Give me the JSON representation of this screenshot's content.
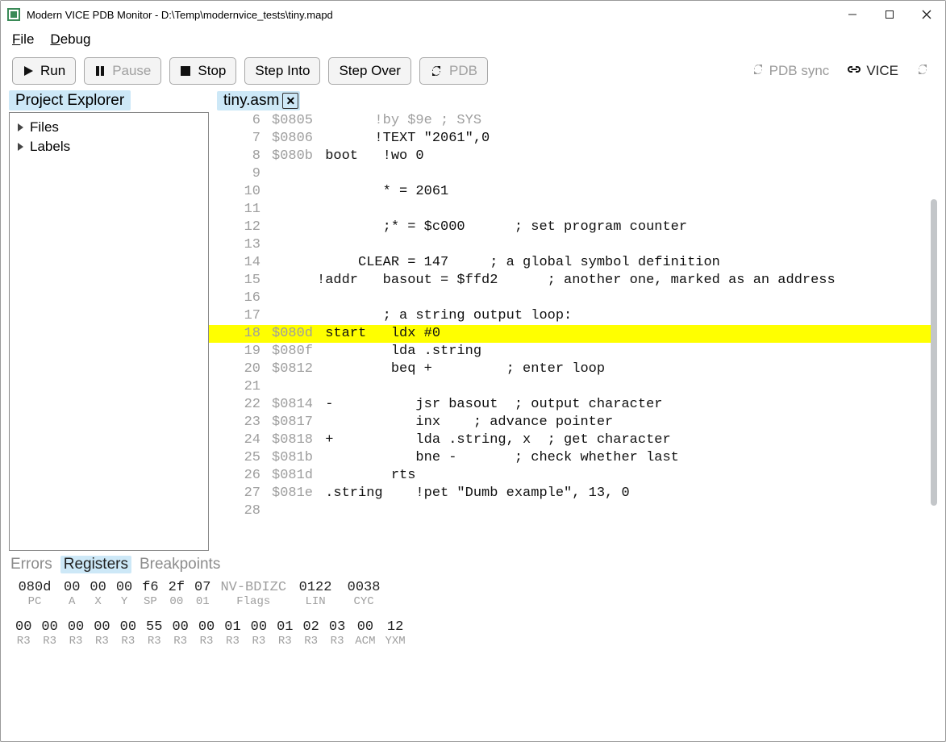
{
  "window": {
    "title": "Modern VICE PDB Monitor - D:\\Temp\\modernvice_tests\\tiny.mapd"
  },
  "menu": {
    "file": "File",
    "debug": "Debug"
  },
  "toolbar": {
    "run": "Run",
    "pause": "Pause",
    "stop": "Stop",
    "step_into": "Step Into",
    "step_over": "Step Over",
    "pdb": "PDB",
    "pdb_sync": "PDB sync",
    "vice": "VICE"
  },
  "panels": {
    "project_explorer": "Project Explorer",
    "file_tab": "tiny.asm"
  },
  "explorer": {
    "files": "Files",
    "labels": "Labels"
  },
  "code": {
    "rows": [
      {
        "ln": "6",
        "addr": "$0805",
        "text": "       !by $9e ; SYS",
        "current": false,
        "faded": true
      },
      {
        "ln": "7",
        "addr": "$0806",
        "text": "       !TEXT \"2061\",0",
        "current": false
      },
      {
        "ln": "8",
        "addr": "$080b",
        "text": " boot   !wo 0",
        "current": false
      },
      {
        "ln": "9",
        "addr": "",
        "text": "",
        "current": false
      },
      {
        "ln": "10",
        "addr": "",
        "text": "        * = 2061",
        "current": false
      },
      {
        "ln": "11",
        "addr": "",
        "text": "",
        "current": false
      },
      {
        "ln": "12",
        "addr": "",
        "text": "        ;* = $c000      ; set program counter",
        "current": false
      },
      {
        "ln": "13",
        "addr": "",
        "text": "",
        "current": false
      },
      {
        "ln": "14",
        "addr": "",
        "text": "     CLEAR = 147     ; a global symbol definition",
        "current": false
      },
      {
        "ln": "15",
        "addr": "",
        "text": "!addr   basout = $ffd2      ; another one, marked as an address",
        "current": false
      },
      {
        "ln": "16",
        "addr": "",
        "text": "",
        "current": false
      },
      {
        "ln": "17",
        "addr": "",
        "text": "        ; a string output loop:",
        "current": false
      },
      {
        "ln": "18",
        "addr": "$080d",
        "text": " start   ldx #0",
        "current": true
      },
      {
        "ln": "19",
        "addr": "$080f",
        "text": "         lda .string",
        "current": false
      },
      {
        "ln": "20",
        "addr": "$0812",
        "text": "         beq +         ; enter loop",
        "current": false
      },
      {
        "ln": "21",
        "addr": "",
        "text": "",
        "current": false
      },
      {
        "ln": "22",
        "addr": "$0814",
        "text": " -          jsr basout  ; output character",
        "current": false
      },
      {
        "ln": "23",
        "addr": "$0817",
        "text": "            inx    ; advance pointer",
        "current": false
      },
      {
        "ln": "24",
        "addr": "$0818",
        "text": " +          lda .string, x  ; get character",
        "current": false
      },
      {
        "ln": "25",
        "addr": "$081b",
        "text": "            bne -       ; check whether last",
        "current": false
      },
      {
        "ln": "26",
        "addr": "$081d",
        "text": "         rts",
        "current": false
      },
      {
        "ln": "27",
        "addr": "$081e",
        "text": " .string    !pet \"Dumb example\", 13, 0",
        "current": false
      },
      {
        "ln": "28",
        "addr": "",
        "text": "",
        "current": false
      }
    ]
  },
  "bottom_tabs": {
    "errors": "Errors",
    "registers": "Registers",
    "breakpoints": "Breakpoints"
  },
  "registers": {
    "row1": [
      {
        "val": "080d",
        "lbl": "PC",
        "wide": true
      },
      {
        "val": "00",
        "lbl": "A"
      },
      {
        "val": "00",
        "lbl": "X"
      },
      {
        "val": "00",
        "lbl": "Y"
      },
      {
        "val": "f6",
        "lbl": "SP"
      },
      {
        "val": "2f",
        "lbl": "00"
      },
      {
        "val": "07",
        "lbl": "01"
      },
      {
        "val": "NV-BDIZC",
        "lbl": "Flags",
        "wide": true,
        "muted": true
      },
      {
        "val": "0122",
        "lbl": "LIN",
        "wide": true
      },
      {
        "val": "0038",
        "lbl": "CYC",
        "wide": true
      }
    ],
    "row2": [
      {
        "val": "00",
        "lbl": "R3"
      },
      {
        "val": "00",
        "lbl": "R3"
      },
      {
        "val": "00",
        "lbl": "R3"
      },
      {
        "val": "00",
        "lbl": "R3"
      },
      {
        "val": "00",
        "lbl": "R3"
      },
      {
        "val": "55",
        "lbl": "R3"
      },
      {
        "val": "00",
        "lbl": "R3"
      },
      {
        "val": "00",
        "lbl": "R3"
      },
      {
        "val": "01",
        "lbl": "R3"
      },
      {
        "val": "00",
        "lbl": "R3"
      },
      {
        "val": "01",
        "lbl": "R3"
      },
      {
        "val": "02",
        "lbl": "R3"
      },
      {
        "val": "03",
        "lbl": "R3"
      },
      {
        "val": "00",
        "lbl": "ACM"
      },
      {
        "val": "12",
        "lbl": "YXM"
      }
    ]
  }
}
